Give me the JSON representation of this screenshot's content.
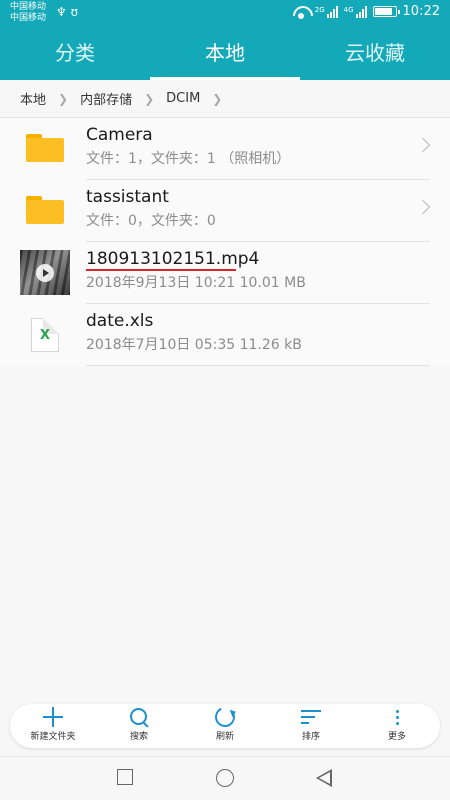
{
  "status_bar": {
    "carrier_line1": "中国移动",
    "carrier_line2": "中国移动",
    "left_icons": "♆ ʊ",
    "net1": "2G",
    "net2": "4G",
    "time": "10:22"
  },
  "tabs": [
    {
      "label": "分类",
      "active": false
    },
    {
      "label": "本地",
      "active": true
    },
    {
      "label": "云收藏",
      "active": false
    }
  ],
  "breadcrumb": [
    "本地",
    "内部存储",
    "DCIM"
  ],
  "files": [
    {
      "name": "Camera",
      "sub": "文件：1，文件夹：1  （照相机）",
      "icon": "folder-icon",
      "has_chevron": true
    },
    {
      "name": "tassistant",
      "sub": "文件：0，文件夹：0",
      "icon": "folder-icon",
      "has_chevron": true
    },
    {
      "name": "180913102151.mp4",
      "sub": "2018年9月13日 10:21 10.01 MB",
      "icon": "video-thumbnail",
      "has_chevron": false
    },
    {
      "name": "date.xls",
      "sub": "2018年7月10日 05:35 11.26 kB",
      "icon": "excel-file-icon",
      "has_chevron": false
    }
  ],
  "xls_letter": "X",
  "toolbar": [
    {
      "label": "新建文件夹",
      "icon": "plus-icon"
    },
    {
      "label": "搜索",
      "icon": "search-icon"
    },
    {
      "label": "刷新",
      "icon": "refresh-icon"
    },
    {
      "label": "排序",
      "icon": "sort-icon"
    },
    {
      "label": "更多",
      "icon": "more-icon"
    }
  ],
  "colors": {
    "header": "#14a9b9",
    "accent_blue": "#1b8fd0",
    "folder": "#fbbf24",
    "underline": "#d9242b"
  }
}
